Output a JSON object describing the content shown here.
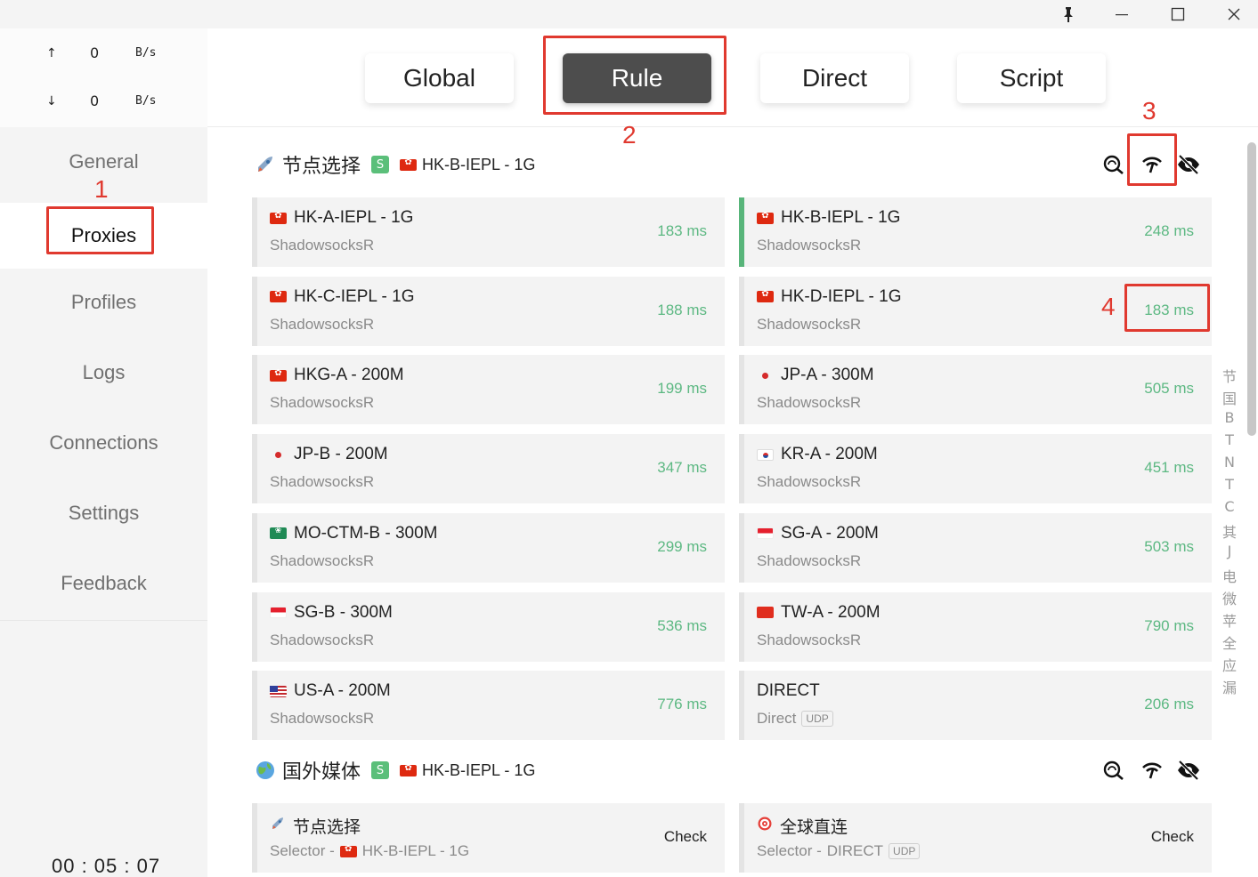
{
  "titlebar": {
    "pin_icon": "pin-icon",
    "minimize_icon": "minimize-icon",
    "maximize_icon": "maximize-icon",
    "close_icon": "close-icon"
  },
  "traffic": {
    "upload_arrow": "↑",
    "upload_value": "0",
    "upload_unit": "B/s",
    "download_arrow": "↓",
    "download_value": "0",
    "download_unit": "B/s"
  },
  "sidebar": {
    "items": [
      {
        "label": "General"
      },
      {
        "label": "Proxies"
      },
      {
        "label": "Profiles"
      },
      {
        "label": "Logs"
      },
      {
        "label": "Connections"
      },
      {
        "label": "Settings"
      },
      {
        "label": "Feedback"
      }
    ],
    "active": "Proxies",
    "timer": "00 : 05 : 07"
  },
  "modes": {
    "items": [
      {
        "label": "Global"
      },
      {
        "label": "Rule"
      },
      {
        "label": "Direct"
      },
      {
        "label": "Script"
      }
    ],
    "active": "Rule"
  },
  "groups": [
    {
      "name": "节点选择",
      "icon": "rocket-icon",
      "type_badge": "S",
      "selected_flag": "hk",
      "selected": "HK-B-IEPL - 1G",
      "tools": [
        "delay-search-icon",
        "latency-test-icon",
        "hide-icon"
      ]
    },
    {
      "name": "国外媒体",
      "icon": "globe-icon",
      "type_badge": "S",
      "selected_flag": "hk",
      "selected": "HK-B-IEPL - 1G",
      "tools": [
        "delay-search-icon",
        "latency-test-icon",
        "hide-icon"
      ]
    }
  ],
  "proxies": [
    {
      "name": "HK-A-IEPL - 1G",
      "flag": "hk",
      "type": "ShadowsocksR",
      "delay": "183 ms"
    },
    {
      "name": "HK-B-IEPL - 1G",
      "flag": "hk",
      "type": "ShadowsocksR",
      "delay": "248 ms",
      "selected": true
    },
    {
      "name": "HK-C-IEPL - 1G",
      "flag": "hk",
      "type": "ShadowsocksR",
      "delay": "188 ms"
    },
    {
      "name": "HK-D-IEPL - 1G",
      "flag": "hk",
      "type": "ShadowsocksR",
      "delay": "183 ms"
    },
    {
      "name": "HKG-A - 200M",
      "flag": "hk",
      "type": "ShadowsocksR",
      "delay": "199 ms"
    },
    {
      "name": "JP-A - 300M",
      "flag": "jp",
      "type": "ShadowsocksR",
      "delay": "505 ms"
    },
    {
      "name": "JP-B - 200M",
      "flag": "jp",
      "type": "ShadowsocksR",
      "delay": "347 ms"
    },
    {
      "name": "KR-A - 200M",
      "flag": "kr",
      "type": "ShadowsocksR",
      "delay": "451 ms"
    },
    {
      "name": "MO-CTM-B - 300M",
      "flag": "mo",
      "type": "ShadowsocksR",
      "delay": "299 ms"
    },
    {
      "name": "SG-A - 200M",
      "flag": "sg",
      "type": "ShadowsocksR",
      "delay": "503 ms"
    },
    {
      "name": "SG-B - 300M",
      "flag": "sg",
      "type": "ShadowsocksR",
      "delay": "536 ms"
    },
    {
      "name": "TW-A - 200M",
      "flag": "tw",
      "type": "ShadowsocksR",
      "delay": "790 ms"
    },
    {
      "name": "US-A - 200M",
      "flag": "us",
      "type": "ShadowsocksR",
      "delay": "776 ms"
    },
    {
      "name": "DIRECT",
      "flag": "",
      "type": "Direct",
      "udp": "UDP",
      "delay": "206 ms"
    }
  ],
  "media_group_items": [
    {
      "icon": "rocket-icon",
      "name": "节点选择",
      "sub_prefix": "Selector - ",
      "sub_flag": "hk",
      "sub_value": "HK-B-IEPL - 1G",
      "action": "Check"
    },
    {
      "icon": "target-icon",
      "name": "全球直连",
      "sub_prefix": "Selector - ",
      "sub_value": "DIRECT",
      "udp": "UDP",
      "action": "Check"
    }
  ],
  "index_letters": [
    "节",
    "国",
    "B",
    "T",
    "N",
    "T",
    "C",
    "其",
    "J",
    "电",
    "微",
    "苹",
    "全",
    "应",
    "漏"
  ],
  "annotations": [
    "1",
    "2",
    "3",
    "4"
  ],
  "colors": {
    "accent_green": "#5cb882",
    "annotation_red": "#e0392f",
    "active_mode_bg": "#4d4d4d"
  }
}
